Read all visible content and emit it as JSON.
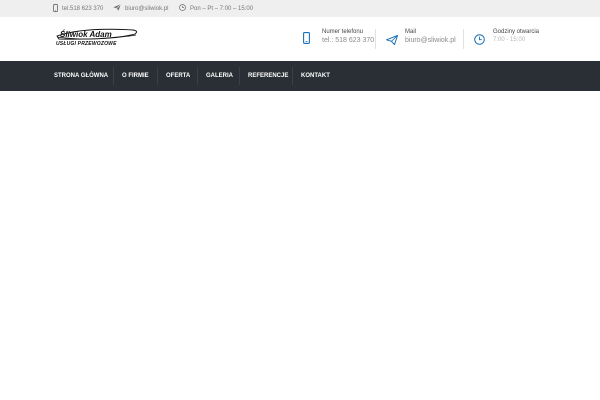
{
  "topbar": {
    "phone": "tel.518 623 370",
    "email": "biuro@sliwiok.pl",
    "hours": "Pon – Pt – 7:00 – 15:00"
  },
  "logo": {
    "line1": "Śliwiok Adam",
    "line2": "Usługi Przewozowe"
  },
  "header": {
    "contacts": [
      {
        "label": "Numer telefonu",
        "value": "tel.: 518 623 370",
        "icon": "mobile-phone-icon"
      },
      {
        "label": "Mail",
        "value": "biuro@sliwiok.pl",
        "icon": "paper-plane-icon"
      },
      {
        "label": "Godziny otwarcia",
        "value": "7:00 - 15:00",
        "icon": "clock-icon"
      }
    ]
  },
  "nav": {
    "items": [
      {
        "label": "Strona główna"
      },
      {
        "label": "O firmie"
      },
      {
        "label": "Oferta"
      },
      {
        "label": "Galeria"
      },
      {
        "label": "Referencje"
      },
      {
        "label": "Kontakt"
      }
    ]
  },
  "colors": {
    "accent": "#1a6fb5",
    "nav_bg": "#2a2f35",
    "topbar_bg": "#efefef"
  }
}
